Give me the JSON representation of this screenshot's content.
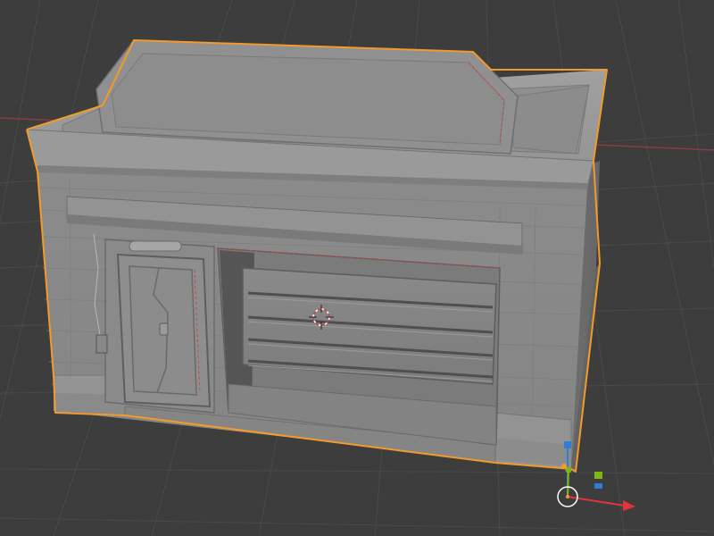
{
  "viewport": {
    "background": "#3d3d3d",
    "grid_color": "#4a4a4a",
    "x_axis_color": "#8c3a44",
    "selection_outline_color": "#f39a2a",
    "model_base_color": "#8e8e8e",
    "seam_color": "#d04040",
    "gizmo": {
      "x_color": "#e3323c",
      "y_color": "#7fb515",
      "z_color": "#2f7dd6"
    }
  },
  "model": {
    "name_icon": "building-mesh",
    "parts": [
      "roof-parapet",
      "sign-panel",
      "awning",
      "door",
      "garage-shutter",
      "light-fixture",
      "switch-box"
    ]
  }
}
